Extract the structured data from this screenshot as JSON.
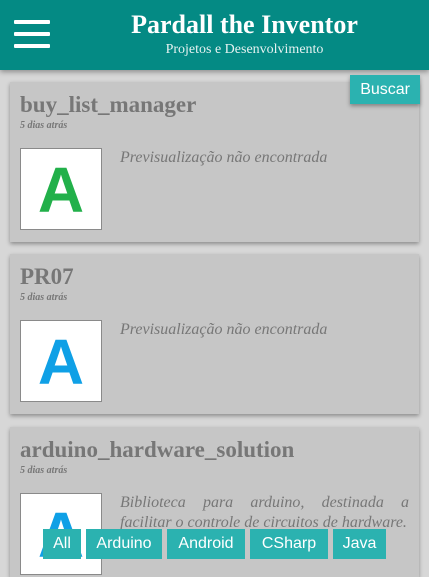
{
  "header": {
    "title": "Pardall the Inventor",
    "subtitle": "Projetos e Desenvolvimento"
  },
  "search": {
    "label": "Buscar"
  },
  "cards": [
    {
      "title": "buy_list_manager",
      "date": "5 dias atrás",
      "thumb_letter": "A",
      "thumb_color": "#22b04a",
      "description": "Previsualização não encontrada"
    },
    {
      "title": "PR07",
      "date": "5 dias atrás",
      "thumb_letter": "A",
      "thumb_color": "#0fa0e6",
      "description": "Previsualização não encontrada"
    },
    {
      "title": "arduino_hardware_solution",
      "date": "5 dias atrás",
      "thumb_letter": "A",
      "thumb_color": "#0fa0e6",
      "description": "Biblioteca para arduino, destinada a facilitar o controle de circuitos de hardware."
    }
  ],
  "tags": [
    "All",
    "Arduino",
    "Android",
    "CSharp",
    "Java"
  ],
  "colors": {
    "header": "#048a84",
    "accent": "#2bb2b0",
    "card": "#c6c6c6",
    "background": "#d7d7d7"
  }
}
